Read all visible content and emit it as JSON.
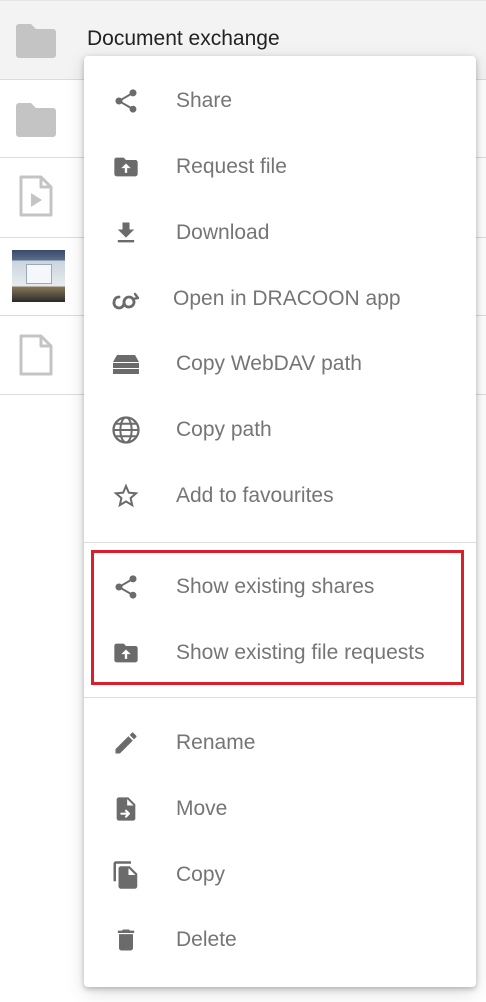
{
  "file_list": {
    "rows": [
      {
        "title": "Document exchange",
        "icon": "folder-icon"
      },
      {
        "title": "",
        "icon": "folder-icon"
      },
      {
        "title": "",
        "icon": "video-file-icon"
      },
      {
        "title": "",
        "icon": "image-thumbnail"
      },
      {
        "title": "",
        "icon": "file-icon"
      }
    ]
  },
  "menu": {
    "group1": [
      {
        "label": "Share",
        "icon": "share-icon"
      },
      {
        "label": "Request file",
        "icon": "folder-upload-icon"
      },
      {
        "label": "Download",
        "icon": "download-icon"
      },
      {
        "label": "Open in DRACOON app",
        "icon": "dracoon-app-icon"
      },
      {
        "label": "Copy WebDAV path",
        "icon": "storage-icon"
      },
      {
        "label": "Copy path",
        "icon": "globe-icon"
      },
      {
        "label": "Add to favourites",
        "icon": "star-outline-icon"
      }
    ],
    "group2": [
      {
        "label": "Show existing shares",
        "icon": "share-icon"
      },
      {
        "label": "Show existing file requests",
        "icon": "folder-upload-icon"
      }
    ],
    "group3": [
      {
        "label": "Rename",
        "icon": "pencil-icon"
      },
      {
        "label": "Move",
        "icon": "move-file-icon"
      },
      {
        "label": "Copy",
        "icon": "copy-icon"
      },
      {
        "label": "Delete",
        "icon": "trash-icon"
      }
    ]
  },
  "colors": {
    "icon": "#6b6b6b",
    "label": "#757575",
    "highlight_border": "#d9202a",
    "folder": "#c4c4c4"
  }
}
